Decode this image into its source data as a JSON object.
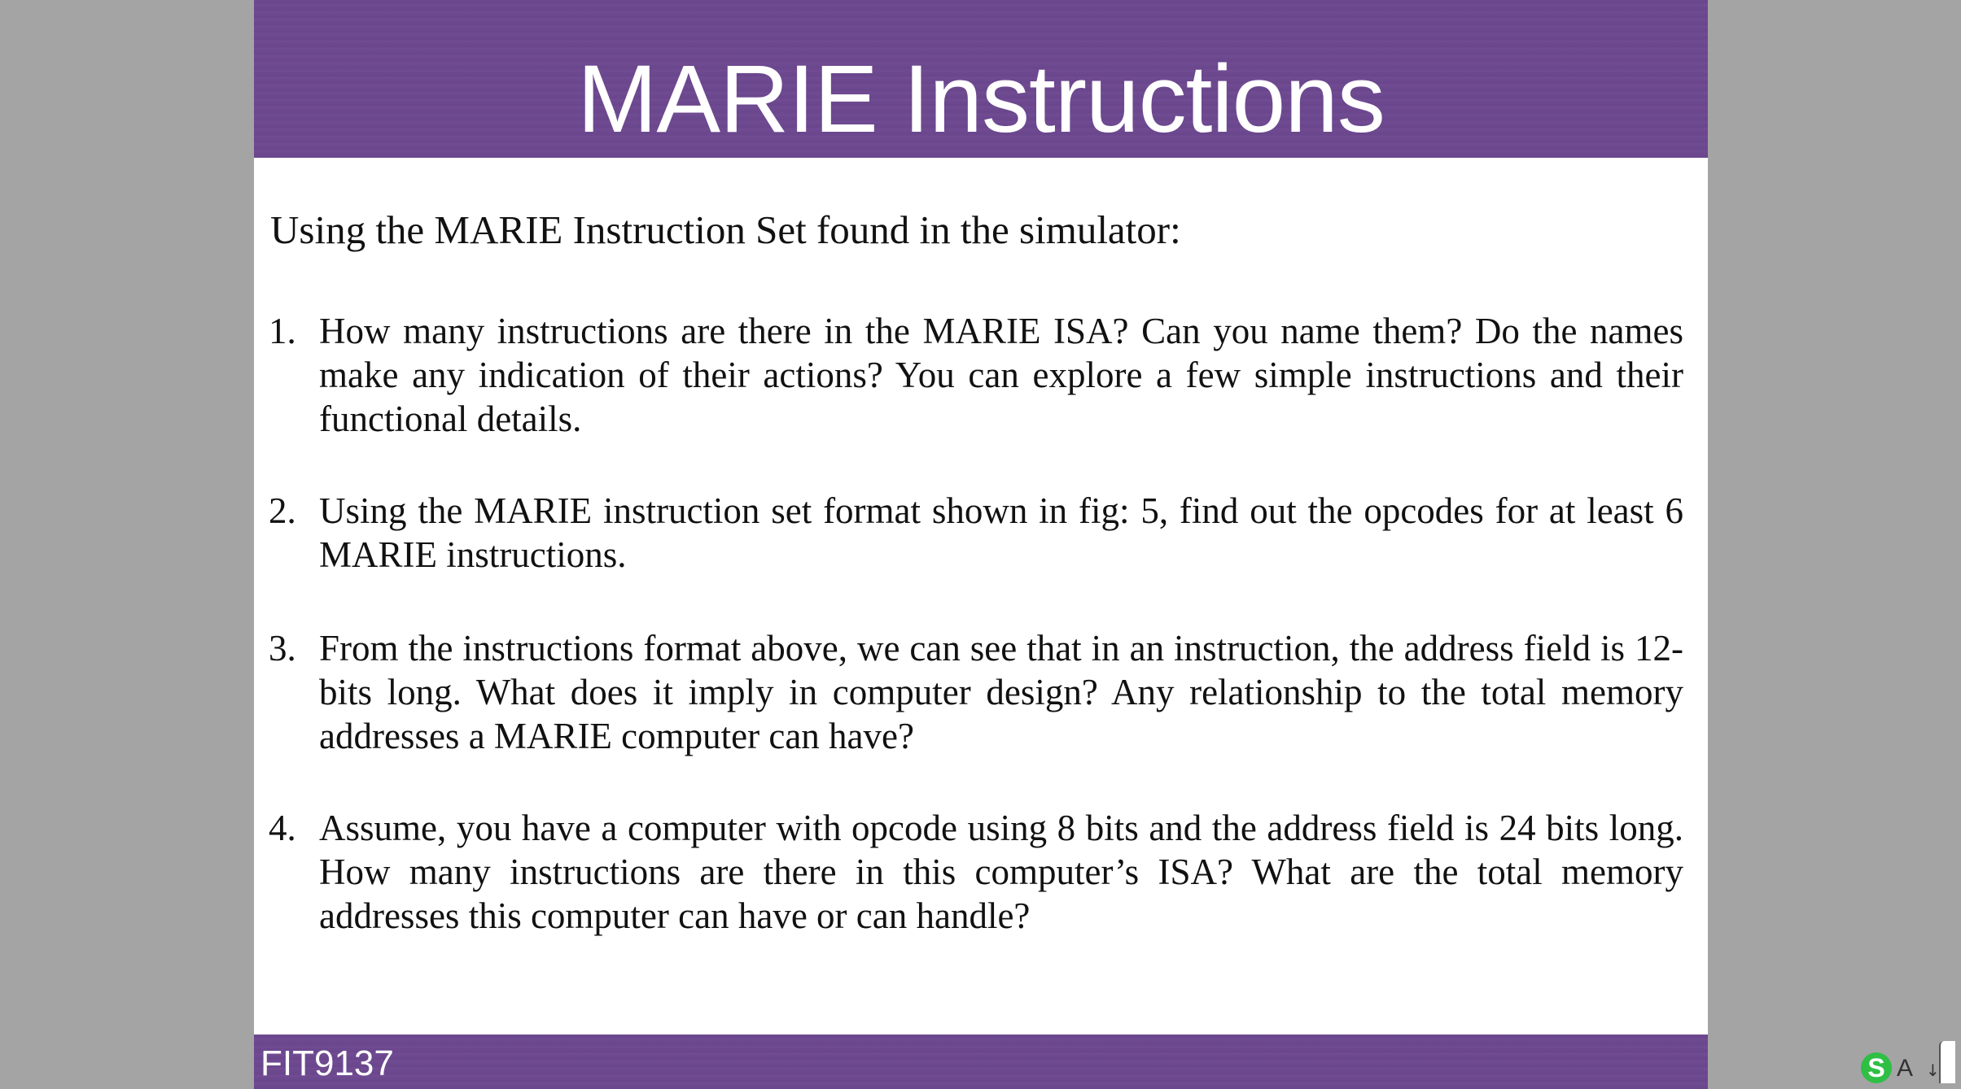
{
  "slide": {
    "title": "MARIE Instructions",
    "intro": "Using the MARIE Instruction Set found in the simulator:",
    "questions": [
      {
        "number": "1.",
        "text": "How many instructions are there in the MARIE ISA? Can you name them? Do the names make any indication of their actions? You can explore a few simple instructions and their functional details."
      },
      {
        "number": "2.",
        "text": "Using the MARIE instruction set format shown in fig: 5, find out the opcodes for at least 6 MARIE instructions."
      },
      {
        "number": "3.",
        "text": "From the instructions format above, we can see that in an instruction, the address field is 12-bits long. What does it imply in computer design? Any relationship to the total memory addresses a MARIE computer can have?"
      },
      {
        "number": "4.",
        "text": "Assume, you have a computer with opcode using 8 bits and the address field is 24 bits long. How many instructions are there in this computer’s ISA? What are the total memory addresses this computer can have or can handle?"
      }
    ],
    "footer_code": "FIT9137"
  },
  "tray": {
    "ime_logo_icon": "ime-logo-icon",
    "ime_logo_letter": "S",
    "language_indicator": "A",
    "menu_arrow_icon": "chevron-down-icon"
  },
  "colors": {
    "band_purple": "#6d4990",
    "background_gray": "#a4a4a4",
    "text_white": "#ffffff",
    "body_text": "#111111",
    "ime_green": "#2fbf45"
  }
}
